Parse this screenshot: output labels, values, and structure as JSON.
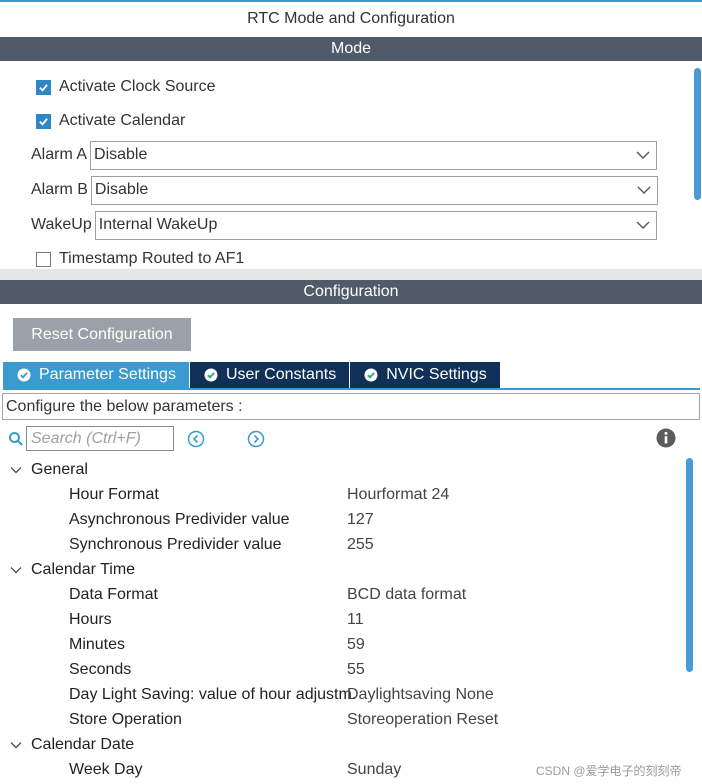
{
  "window": {
    "title": "RTC Mode and Configuration"
  },
  "mode": {
    "header": "Mode",
    "activate_clock_source": {
      "label": "Activate Clock Source",
      "checked": true
    },
    "activate_calendar": {
      "label": "Activate Calendar",
      "checked": true
    },
    "alarm_a": {
      "label": "Alarm A",
      "value": "Disable"
    },
    "alarm_b": {
      "label": "Alarm B",
      "value": "Disable"
    },
    "wakeup": {
      "label": "WakeUp",
      "value": "Internal WakeUp"
    },
    "timestamp": {
      "label": "Timestamp Routed to AF1",
      "checked": false
    }
  },
  "configuration": {
    "header": "Configuration",
    "reset_label": "Reset Configuration",
    "tabs": [
      {
        "label": "Parameter Settings",
        "active": true
      },
      {
        "label": "User Constants",
        "active": false
      },
      {
        "label": "NVIC Settings",
        "active": false
      }
    ],
    "instructions": "Configure the below parameters :",
    "search_placeholder": "Search (Ctrl+F)",
    "groups": [
      {
        "name": "General",
        "params": [
          {
            "name": "Hour Format",
            "value": "Hourformat 24"
          },
          {
            "name": "Asynchronous Predivider value",
            "value": "127"
          },
          {
            "name": "Synchronous Predivider value",
            "value": "255"
          }
        ]
      },
      {
        "name": "Calendar Time",
        "params": [
          {
            "name": "Data Format",
            "value": "BCD data format"
          },
          {
            "name": "Hours",
            "value": "11"
          },
          {
            "name": "Minutes",
            "value": "59"
          },
          {
            "name": "Seconds",
            "value": "55"
          },
          {
            "name": "Day Light Saving: value of hour adjustm.",
            "value": "Daylightsaving None"
          },
          {
            "name": "Store Operation",
            "value": "Storeoperation Reset"
          }
        ]
      },
      {
        "name": "Calendar Date",
        "params": [
          {
            "name": "Week Day",
            "value": "Sunday"
          }
        ]
      }
    ]
  },
  "watermark": "CSDN @爱学电子的刻刻帝",
  "colors": {
    "accent": "#3a9bd1",
    "header_bar": "#505a68",
    "tab_dark": "#0f3158",
    "check": "#2d86c6"
  }
}
